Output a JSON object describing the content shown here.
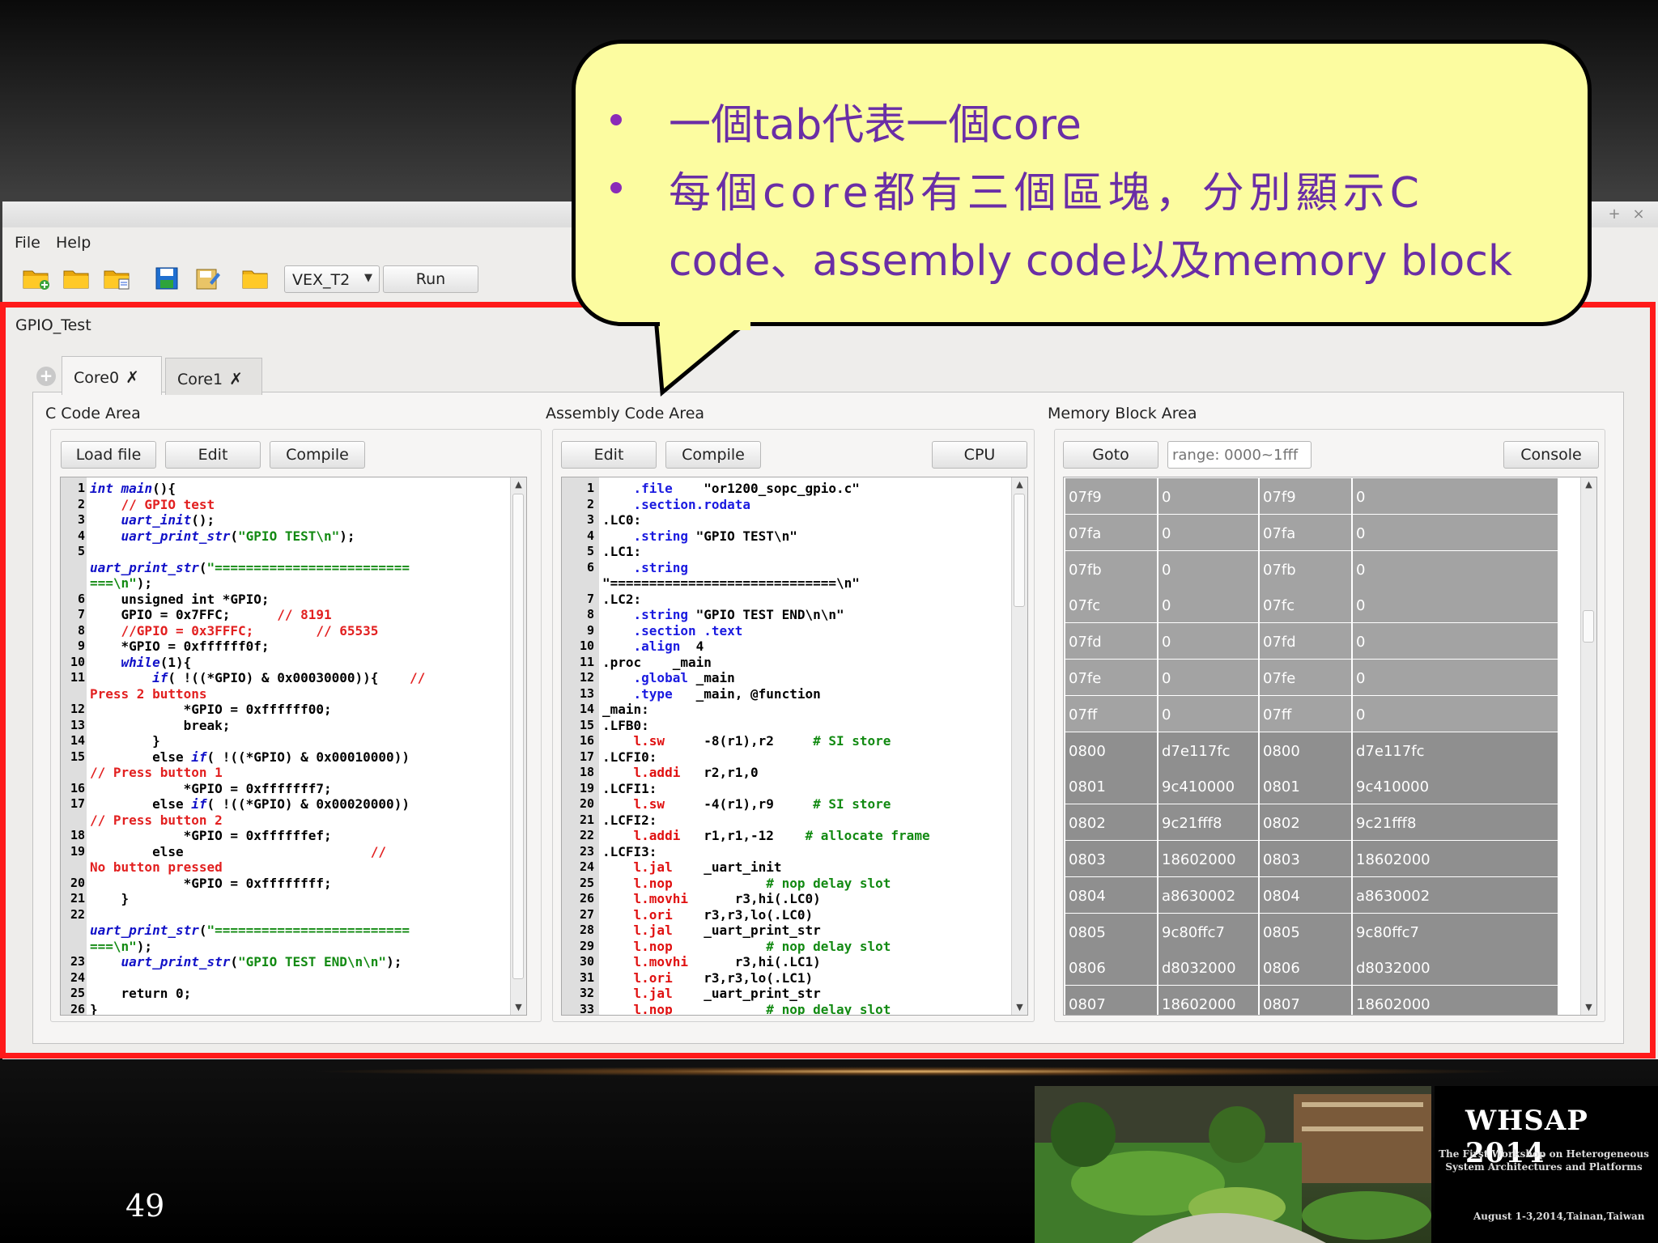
{
  "window": {
    "menu": [
      "File",
      "Help"
    ],
    "toolbar": {
      "icons": [
        "new-project-icon",
        "open-folder-icon",
        "open-file-icon",
        "save-icon",
        "save-as-icon",
        "folder-icon"
      ],
      "platform_select": "VEX_T2",
      "run_label": "Run"
    },
    "project_name": "GPIO_Test",
    "tabs": [
      {
        "label": "Core0",
        "active": true
      },
      {
        "label": "Core1",
        "active": false
      }
    ],
    "areas": {
      "c_code": {
        "label": "C Code Area",
        "buttons": [
          "Load file",
          "Edit",
          "Compile"
        ]
      },
      "assembly": {
        "label": "Assembly Code Area",
        "buttons": [
          "Edit",
          "Compile",
          "CPU"
        ]
      },
      "memory": {
        "label": "Memory Block Area",
        "goto_label": "Goto",
        "range_placeholder": "range: 0000~1fff",
        "console_label": "Console"
      }
    }
  },
  "c_code_lines": [
    {
      "n": "1",
      "t": [
        [
          "kw",
          "int"
        ],
        [
          "kb",
          " "
        ],
        [
          "kw",
          "main"
        ],
        [
          "kb",
          "(){"
        ]
      ]
    },
    {
      "n": "2",
      "t": [
        [
          "kb",
          "    "
        ],
        [
          "cm",
          "// GPIO test"
        ]
      ]
    },
    {
      "n": "3",
      "t": [
        [
          "kb",
          "    "
        ],
        [
          "kw",
          "uart_init"
        ],
        [
          "kb",
          "();"
        ]
      ]
    },
    {
      "n": "4",
      "t": [
        [
          "kb",
          "    "
        ],
        [
          "kw",
          "uart_print_str"
        ],
        [
          "kb",
          "("
        ],
        [
          "st",
          "\"GPIO TEST\\n\""
        ],
        [
          "kb",
          ");"
        ]
      ]
    },
    {
      "n": "5",
      "t": [
        [
          "kb",
          ""
        ]
      ]
    },
    {
      "n": "",
      "t": [
        [
          "kw",
          "uart_print_str"
        ],
        [
          "kb",
          "("
        ],
        [
          "st",
          "\"========================="
        ]
      ]
    },
    {
      "n": "",
      "t": [
        [
          "st",
          "===\\n\""
        ],
        [
          "kb",
          ");"
        ]
      ]
    },
    {
      "n": "6",
      "t": [
        [
          "kb",
          "    "
        ],
        [
          "kb",
          "unsigned int"
        ],
        [
          "kb",
          " *GPIO;"
        ]
      ]
    },
    {
      "n": "7",
      "t": [
        [
          "kb",
          "    GPIO = 0x7FFC;      "
        ],
        [
          "cm",
          "// 8191"
        ]
      ]
    },
    {
      "n": "8",
      "t": [
        [
          "kb",
          "    "
        ],
        [
          "cm",
          "//GPIO = 0x3FFFC;"
        ],
        [
          "kb",
          "        "
        ],
        [
          "cm",
          "// 65535"
        ]
      ]
    },
    {
      "n": "9",
      "t": [
        [
          "kb",
          "    *GPIO = 0xffffff0f;"
        ]
      ]
    },
    {
      "n": "10",
      "t": [
        [
          "kb",
          "    "
        ],
        [
          "kw",
          "while"
        ],
        [
          "kb",
          "(1){"
        ]
      ]
    },
    {
      "n": "11",
      "t": [
        [
          "kb",
          "        "
        ],
        [
          "kw",
          "if"
        ],
        [
          "kb",
          "( !((*GPIO) & 0x00030000)){    "
        ],
        [
          "cm",
          "//"
        ]
      ]
    },
    {
      "n": "",
      "t": [
        [
          "cm",
          "Press 2 buttons"
        ]
      ]
    },
    {
      "n": "12",
      "t": [
        [
          "kb",
          "            *GPIO = 0xffffff00;"
        ]
      ]
    },
    {
      "n": "13",
      "t": [
        [
          "kb",
          "            break;"
        ]
      ]
    },
    {
      "n": "14",
      "t": [
        [
          "kb",
          "        }"
        ]
      ]
    },
    {
      "n": "15",
      "t": [
        [
          "kb",
          "        else "
        ],
        [
          "kw",
          "if"
        ],
        [
          "kb",
          "( !((*GPIO) & 0x00010000))"
        ]
      ]
    },
    {
      "n": "",
      "t": [
        [
          "cm",
          "// Press button 1"
        ]
      ]
    },
    {
      "n": "16",
      "t": [
        [
          "kb",
          "            *GPIO = 0xfffffff7;"
        ]
      ]
    },
    {
      "n": "17",
      "t": [
        [
          "kb",
          "        else "
        ],
        [
          "kw",
          "if"
        ],
        [
          "kb",
          "( !((*GPIO) & 0x00020000))"
        ]
      ]
    },
    {
      "n": "",
      "t": [
        [
          "cm",
          "// Press button 2"
        ]
      ]
    },
    {
      "n": "18",
      "t": [
        [
          "kb",
          "            *GPIO = 0xffffffef;"
        ]
      ]
    },
    {
      "n": "19",
      "t": [
        [
          "kb",
          "        else                        "
        ],
        [
          "cm",
          "//"
        ]
      ]
    },
    {
      "n": "",
      "t": [
        [
          "cm",
          "No button pressed"
        ]
      ]
    },
    {
      "n": "20",
      "t": [
        [
          "kb",
          "            *GPIO = 0xffffffff;"
        ]
      ]
    },
    {
      "n": "21",
      "t": [
        [
          "kb",
          "    }"
        ]
      ]
    },
    {
      "n": "22",
      "t": [
        [
          "kb",
          ""
        ]
      ]
    },
    {
      "n": "",
      "t": [
        [
          "kw",
          "uart_print_str"
        ],
        [
          "kb",
          "("
        ],
        [
          "st",
          "\"========================="
        ]
      ]
    },
    {
      "n": "",
      "t": [
        [
          "st",
          "===\\n\""
        ],
        [
          "kb",
          ");"
        ]
      ]
    },
    {
      "n": "23",
      "t": [
        [
          "kb",
          "    "
        ],
        [
          "kw",
          "uart_print_str"
        ],
        [
          "kb",
          "("
        ],
        [
          "st",
          "\"GPIO TEST END\\n\\n\""
        ],
        [
          "kb",
          ");"
        ]
      ]
    },
    {
      "n": "24",
      "t": [
        [
          "kb",
          ""
        ]
      ]
    },
    {
      "n": "25",
      "t": [
        [
          "kb",
          "    return 0;"
        ]
      ]
    },
    {
      "n": "26",
      "t": [
        [
          "kb",
          "}"
        ]
      ]
    }
  ],
  "asm_lines": [
    {
      "n": "1",
      "t": [
        [
          "kb",
          "    "
        ],
        [
          "dir",
          ".file"
        ],
        [
          "kb",
          "    \"or1200_sopc_gpio.c\""
        ]
      ]
    },
    {
      "n": "2",
      "t": [
        [
          "kb",
          "    "
        ],
        [
          "dir",
          ".section"
        ],
        [
          "dir",
          ".rodata"
        ]
      ]
    },
    {
      "n": "3",
      "t": [
        [
          "kb",
          ".LC0:"
        ]
      ]
    },
    {
      "n": "4",
      "t": [
        [
          "kb",
          "    "
        ],
        [
          "dir",
          ".string"
        ],
        [
          "kb",
          " \"GPIO TEST\\n\""
        ]
      ]
    },
    {
      "n": "5",
      "t": [
        [
          "kb",
          ".LC1:"
        ]
      ]
    },
    {
      "n": "6",
      "t": [
        [
          "kb",
          "    "
        ],
        [
          "dir",
          ".string"
        ]
      ]
    },
    {
      "n": "",
      "t": [
        [
          "kb",
          "\"=============================\\n\""
        ]
      ]
    },
    {
      "n": "7",
      "t": [
        [
          "kb",
          ".LC2:"
        ]
      ]
    },
    {
      "n": "8",
      "t": [
        [
          "kb",
          "    "
        ],
        [
          "dir",
          ".string"
        ],
        [
          "kb",
          " \"GPIO TEST END\\n\\n\""
        ]
      ]
    },
    {
      "n": "9",
      "t": [
        [
          "kb",
          "    "
        ],
        [
          "dir",
          ".section"
        ],
        [
          "kb",
          " "
        ],
        [
          "dir",
          ".text"
        ]
      ]
    },
    {
      "n": "10",
      "t": [
        [
          "kb",
          "    "
        ],
        [
          "dir",
          ".align"
        ],
        [
          "kb",
          "  4"
        ]
      ]
    },
    {
      "n": "11",
      "t": [
        [
          "kb",
          ".proc    _main"
        ]
      ]
    },
    {
      "n": "12",
      "t": [
        [
          "kb",
          "    "
        ],
        [
          "dir",
          ".global"
        ],
        [
          "kb",
          " _main"
        ]
      ]
    },
    {
      "n": "13",
      "t": [
        [
          "kb",
          "    "
        ],
        [
          "dir",
          ".type"
        ],
        [
          "kb",
          "   _main, @function"
        ]
      ]
    },
    {
      "n": "14",
      "t": [
        [
          "kb",
          "_main:"
        ]
      ]
    },
    {
      "n": "15",
      "t": [
        [
          "kb",
          ".LFB0:"
        ]
      ]
    },
    {
      "n": "16",
      "t": [
        [
          "kb",
          "    "
        ],
        [
          "ins",
          "l.sw"
        ],
        [
          "kb",
          "     -8(r1),r2     "
        ],
        [
          "st",
          "# SI store"
        ]
      ]
    },
    {
      "n": "17",
      "t": [
        [
          "kb",
          ".LCFI0:"
        ]
      ]
    },
    {
      "n": "18",
      "t": [
        [
          "kb",
          "    "
        ],
        [
          "ins",
          "l.addi"
        ],
        [
          "kb",
          "   r2,r1,0"
        ]
      ]
    },
    {
      "n": "19",
      "t": [
        [
          "kb",
          ".LCFI1:"
        ]
      ]
    },
    {
      "n": "20",
      "t": [
        [
          "kb",
          "    "
        ],
        [
          "ins",
          "l.sw"
        ],
        [
          "kb",
          "     -4(r1),r9     "
        ],
        [
          "st",
          "# SI store"
        ]
      ]
    },
    {
      "n": "21",
      "t": [
        [
          "kb",
          ".LCFI2:"
        ]
      ]
    },
    {
      "n": "22",
      "t": [
        [
          "kb",
          "    "
        ],
        [
          "ins",
          "l.addi"
        ],
        [
          "kb",
          "   r1,r1,-12    "
        ],
        [
          "st",
          "# allocate frame"
        ]
      ]
    },
    {
      "n": "23",
      "t": [
        [
          "kb",
          ".LCFI3:"
        ]
      ]
    },
    {
      "n": "24",
      "t": [
        [
          "kb",
          "    "
        ],
        [
          "ins",
          "l.jal"
        ],
        [
          "kb",
          "    _uart_init"
        ]
      ]
    },
    {
      "n": "25",
      "t": [
        [
          "kb",
          "    "
        ],
        [
          "ins",
          "l.nop"
        ],
        [
          "kb",
          "            "
        ],
        [
          "st",
          "# nop delay slot"
        ]
      ]
    },
    {
      "n": "26",
      "t": [
        [
          "kb",
          "    "
        ],
        [
          "ins",
          "l.movhi"
        ],
        [
          "kb",
          "      r3,hi(.LC0)"
        ]
      ]
    },
    {
      "n": "27",
      "t": [
        [
          "kb",
          "    "
        ],
        [
          "ins",
          "l.ori"
        ],
        [
          "kb",
          "    r3,r3,lo(.LC0)"
        ]
      ]
    },
    {
      "n": "28",
      "t": [
        [
          "kb",
          "    "
        ],
        [
          "ins",
          "l.jal"
        ],
        [
          "kb",
          "    _uart_print_str"
        ]
      ]
    },
    {
      "n": "29",
      "t": [
        [
          "kb",
          "    "
        ],
        [
          "ins",
          "l.nop"
        ],
        [
          "kb",
          "            "
        ],
        [
          "st",
          "# nop delay slot"
        ]
      ]
    },
    {
      "n": "30",
      "t": [
        [
          "kb",
          "    "
        ],
        [
          "ins",
          "l.movhi"
        ],
        [
          "kb",
          "      r3,hi(.LC1)"
        ]
      ]
    },
    {
      "n": "31",
      "t": [
        [
          "kb",
          "    "
        ],
        [
          "ins",
          "l.ori"
        ],
        [
          "kb",
          "    r3,r3,lo(.LC1)"
        ]
      ]
    },
    {
      "n": "32",
      "t": [
        [
          "kb",
          "    "
        ],
        [
          "ins",
          "l.jal"
        ],
        [
          "kb",
          "    _uart_print_str"
        ]
      ]
    },
    {
      "n": "33",
      "t": [
        [
          "kb",
          "    "
        ],
        [
          "ins",
          "l.nop"
        ],
        [
          "kb",
          "            "
        ],
        [
          "st",
          "# nop delay slot"
        ]
      ]
    }
  ],
  "memory_rows": [
    [
      "07f9",
      "0",
      "07f9",
      "0"
    ],
    [
      "07fa",
      "0",
      "07fa",
      "0"
    ],
    [
      "07fb",
      "0",
      "07fb",
      "0"
    ],
    [
      "07fc",
      "0",
      "07fc",
      "0"
    ],
    [
      "07fd",
      "0",
      "07fd",
      "0"
    ],
    [
      "07fe",
      "0",
      "07fe",
      "0"
    ],
    [
      "07ff",
      "0",
      "07ff",
      "0"
    ],
    [
      "0800",
      "d7e117fc",
      "0800",
      "d7e117fc"
    ],
    [
      "0801",
      "9c410000",
      "0801",
      "9c410000"
    ],
    [
      "0802",
      "9c21fff8",
      "0802",
      "9c21fff8"
    ],
    [
      "0803",
      "18602000",
      "0803",
      "18602000"
    ],
    [
      "0804",
      "a8630002",
      "0804",
      "a8630002"
    ],
    [
      "0805",
      "9c80ffc7",
      "0805",
      "9c80ffc7"
    ],
    [
      "0806",
      "d8032000",
      "0806",
      "d8032000"
    ],
    [
      "0807",
      "18602000",
      "0807",
      "18602000"
    ]
  ],
  "memory_colors": {
    "low": "#a3a3a3",
    "high": "#8f8f8f"
  },
  "callout": {
    "bullet1": "一個tab代表一個core",
    "bullet2_line1": "每個core都有三個區塊，分別顯示C",
    "bullet2_line2": "code、assembly code以及memory block"
  },
  "slide_number": "49",
  "logo": {
    "title": "WHSAP   2014",
    "subtitle": "The First Workshop on Heterogeneous System Architectures and Platforms",
    "date": "August 1-3,2014,Tainan,Taiwan"
  }
}
